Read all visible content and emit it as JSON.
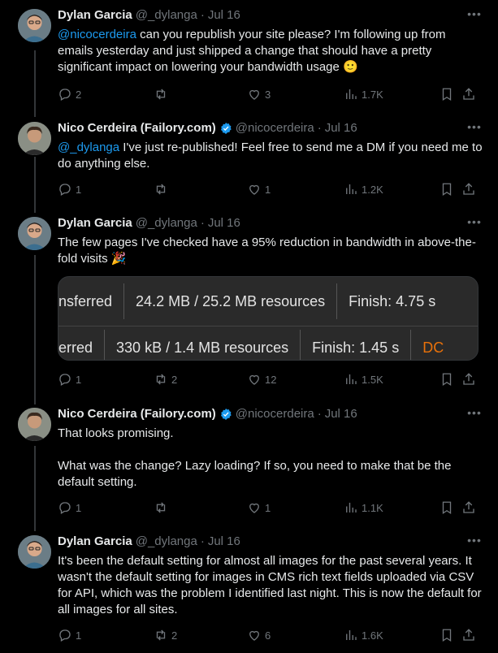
{
  "tweets": [
    {
      "name": "Dylan Garcia",
      "handle": "@_dylanga",
      "sep": "·",
      "date": "Jul 16",
      "verified": false,
      "mention": "@nicocerdeira",
      "text": " can you republish your site please? I'm following up from emails yesterday and just shipped a change that should have a pretty significant impact on lowering your bandwidth usage 🙂",
      "replies": "2",
      "retweets": "",
      "likes": "3",
      "views": "1.7K"
    },
    {
      "name": "Nico Cerdeira (Failory.com)",
      "handle": "@nicocerdeira",
      "sep": "·",
      "date": "Jul 16",
      "verified": true,
      "mention": "@_dylanga",
      "text": " I've just re-published! Feel free to send me a DM if you need me to do anything else.",
      "replies": "1",
      "retweets": "",
      "likes": "1",
      "views": "1.2K"
    },
    {
      "name": "Dylan Garcia",
      "handle": "@_dylanga",
      "sep": "·",
      "date": "Jul 16",
      "verified": false,
      "mention": "",
      "text": "The few pages I've checked have a 95% reduction in bandwidth in above-the-fold visits 🎉",
      "replies": "1",
      "retweets": "2",
      "likes": "12",
      "views": "1.5K",
      "media": {
        "row1": [
          "nsferred",
          "24.2 MB / 25.2 MB resources",
          "Finish: 4.75 s"
        ],
        "row2": [
          "erred",
          "330 kB / 1.4 MB resources",
          "Finish: 1.45 s",
          "DC"
        ]
      }
    },
    {
      "name": "Nico Cerdeira (Failory.com)",
      "handle": "@nicocerdeira",
      "sep": "·",
      "date": "Jul 16",
      "verified": true,
      "mention": "",
      "text": "That looks promising.\n\nWhat was the change? Lazy loading? If so, you need to make that be the default setting.",
      "replies": "1",
      "retweets": "",
      "likes": "1",
      "views": "1.1K"
    },
    {
      "name": "Dylan Garcia",
      "handle": "@_dylanga",
      "sep": "·",
      "date": "Jul 16",
      "verified": false,
      "mention": "",
      "text": "It's been the default setting for almost all images for the past several years. It wasn't the default setting for images in CMS rich text fields uploaded via CSV for API, which was the problem I identified last night. This is now the default for all images for all sites.",
      "replies": "1",
      "retweets": "2",
      "likes": "6",
      "views": "1.6K"
    }
  ],
  "icons": {
    "reply": "reply-icon",
    "retweet": "retweet-icon",
    "like": "like-icon",
    "views": "views-icon",
    "bookmark": "bookmark-icon",
    "share": "share-icon",
    "more": "more-icon",
    "verified": "verified-badge-icon"
  },
  "colors": {
    "background": "#000000",
    "text": "#e7e9ea",
    "muted": "#71767b",
    "link": "#1d9bf0",
    "thread_line": "#333639"
  }
}
